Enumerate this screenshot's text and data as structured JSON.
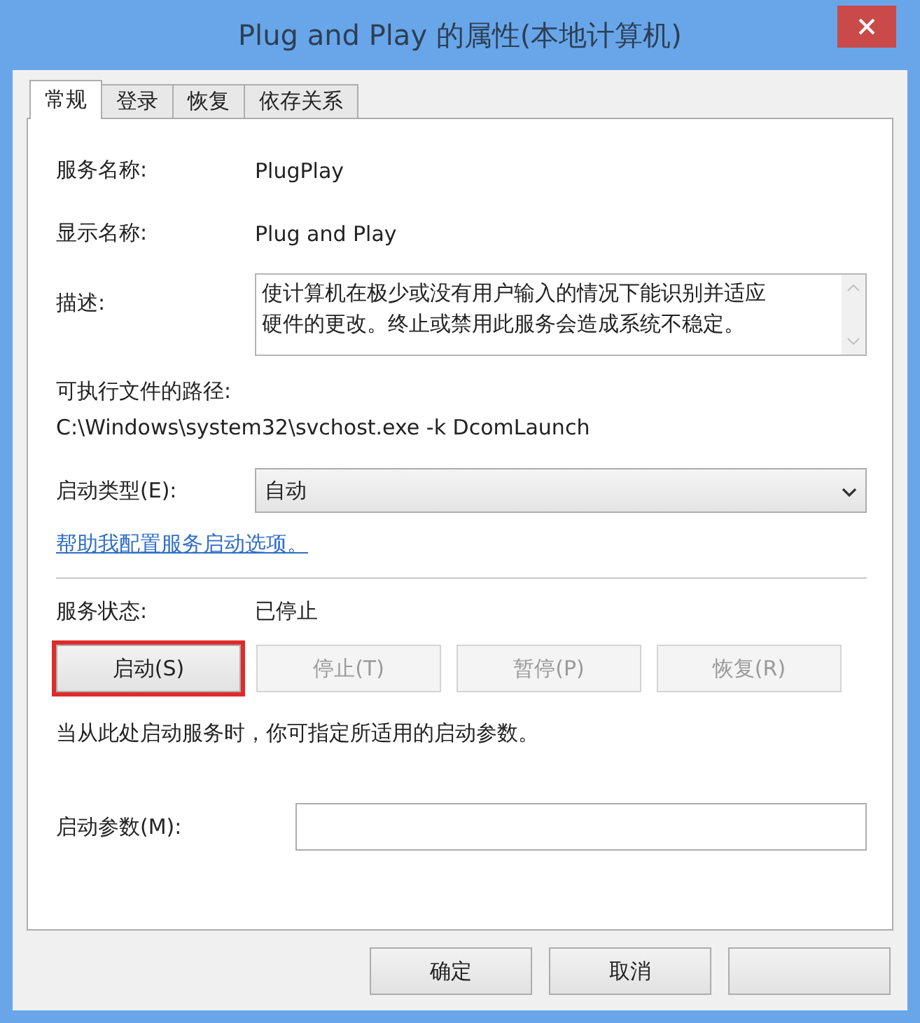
{
  "window": {
    "title": "Plug and Play 的属性(本地计算机)"
  },
  "tabs": [
    {
      "label": "常规",
      "selected": true
    },
    {
      "label": "登录",
      "selected": false
    },
    {
      "label": "恢复",
      "selected": false
    },
    {
      "label": "依存关系",
      "selected": false
    }
  ],
  "fields": [
    {
      "label": "服务名称:",
      "value": "PlugPlay"
    },
    {
      "label": "显示名称:",
      "value": "Plug and Play"
    }
  ],
  "description": {
    "label": "描述:",
    "text": "使计算机在极少或没有用户输入的情况下能识别并适应硬件的更改。终止或禁用此服务会造成系统不稳定。"
  },
  "path": {
    "label": "可执行文件的路径:",
    "value": "C:\\Windows\\system32\\svchost.exe -k DcomLaunch"
  },
  "startup_type": {
    "label": "启动类型(E):",
    "value": "自动"
  },
  "help_link": "帮助我配置服务启动选项。",
  "service_status": {
    "label": "服务状态:",
    "value": "已停止"
  },
  "service_buttons": [
    {
      "label": "启动(S)",
      "disabled": false,
      "highlighted": true
    },
    {
      "label": "停止(T)",
      "disabled": true,
      "highlighted": false
    },
    {
      "label": "暂停(P)",
      "disabled": true,
      "highlighted": false
    },
    {
      "label": "恢复(R)",
      "disabled": true,
      "highlighted": false
    }
  ],
  "hint": "当从此处启动服务时，你可指定所适用的启动参数。",
  "start_params": {
    "label": "启动参数(M):"
  },
  "dialog_buttons": [
    {
      "label": "确定"
    },
    {
      "label": "取消"
    },
    {
      "kind": "button"
    }
  ]
}
